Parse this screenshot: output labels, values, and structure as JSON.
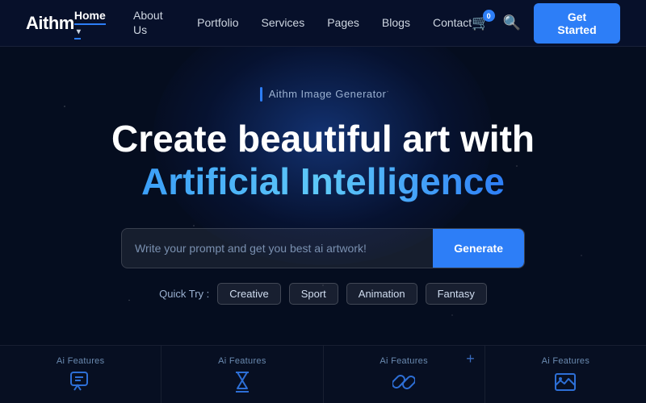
{
  "logo": {
    "text": "Aithm"
  },
  "nav": {
    "links": [
      {
        "label": "Home",
        "active": true,
        "has_arrow": true
      },
      {
        "label": "About Us",
        "active": false,
        "has_arrow": false
      },
      {
        "label": "Portfolio",
        "active": false,
        "has_arrow": false
      },
      {
        "label": "Services",
        "active": false,
        "has_arrow": false
      },
      {
        "label": "Pages",
        "active": false,
        "has_arrow": false
      },
      {
        "label": "Blogs",
        "active": false,
        "has_arrow": false
      },
      {
        "label": "Contact",
        "active": false,
        "has_arrow": false
      }
    ],
    "cart_badge": "0",
    "get_started_label": "Get Started"
  },
  "hero": {
    "badge_text": "Aithm Image Generator",
    "title_line1": "Create beautiful art with",
    "title_line2": "Artificial Intelligence",
    "search_placeholder": "Write your prompt and get you best ai artwork!",
    "generate_label": "Generate",
    "quick_try_label": "Quick Try :",
    "quick_try_tags": [
      "Creative",
      "Sport",
      "Animation",
      "Fantasy"
    ]
  },
  "features": [
    {
      "label": "Ai Features",
      "icon": "💬"
    },
    {
      "label": "Ai Features",
      "icon": "⏳"
    },
    {
      "label": "Ai Features",
      "icon": "🔗",
      "has_plus": true
    },
    {
      "label": "Ai Features",
      "icon": "📊"
    }
  ]
}
